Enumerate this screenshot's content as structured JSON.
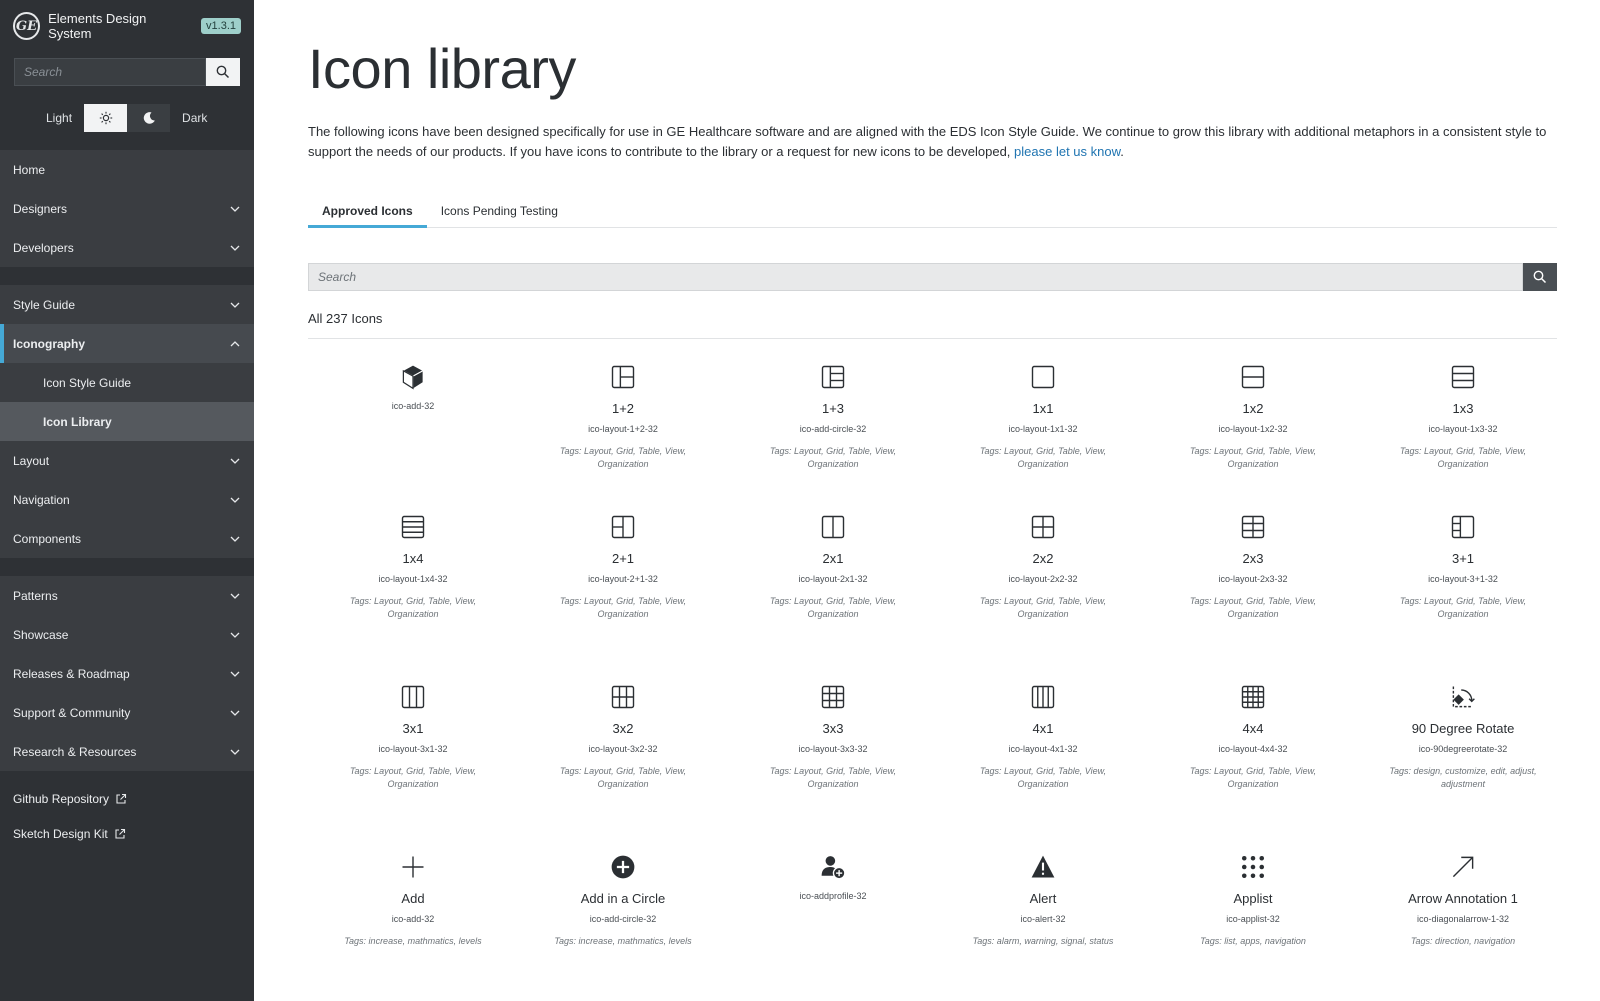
{
  "sidebar": {
    "brand_logo": "GE",
    "brand_name": "Elements Design System",
    "version": "v1.3.1",
    "search_placeholder": "Search",
    "theme_light": "Light",
    "theme_dark": "Dark",
    "nav": {
      "home": "Home",
      "designers": "Designers",
      "developers": "Developers",
      "style_guide": "Style Guide",
      "iconography": "Iconography",
      "icon_style_guide": "Icon Style Guide",
      "icon_library": "Icon Library",
      "layout": "Layout",
      "navigation": "Navigation",
      "components": "Components",
      "patterns": "Patterns",
      "showcase": "Showcase",
      "releases": "Releases & Roadmap",
      "support": "Support & Community",
      "research": "Research & Resources"
    },
    "links": {
      "github": "Github Repository",
      "sketch": "Sketch Design Kit"
    }
  },
  "main": {
    "title": "Icon library",
    "intro_text": "The following icons have been designed specifically for use in GE Healthcare software and are aligned with the EDS Icon Style Guide. We continue to grow this library with additional metaphors in a consistent style to support the needs of our products. If you have icons to contribute to the library or a request for new icons to be developed, ",
    "intro_link": "please let us know",
    "intro_end": ".",
    "tabs": [
      "Approved Icons",
      "Icons Pending Testing"
    ],
    "search_placeholder": "Search",
    "count_label": "All 237 Icons"
  },
  "icons": [
    [
      {
        "icon": "cube-icon",
        "name": "",
        "code": "ico-add-32",
        "tags": ""
      },
      {
        "icon": "layout-1-2-icon",
        "name": "1+2",
        "code": "ico-layout-1+2-32",
        "tags": "Tags: Layout, Grid, Table, View, Organization"
      },
      {
        "icon": "layout-1-3-icon",
        "name": "1+3",
        "code": "ico-add-circle-32",
        "tags": "Tags: Layout, Grid, Table, View, Organization"
      },
      {
        "icon": "layout-1x1-icon",
        "name": "1x1",
        "code": "ico-layout-1x1-32",
        "tags": "Tags: Layout, Grid, Table, View, Organization"
      },
      {
        "icon": "layout-1x2-icon",
        "name": "1x2",
        "code": "ico-layout-1x2-32",
        "tags": "Tags: Layout, Grid, Table, View, Organization"
      },
      {
        "icon": "layout-1x3-icon",
        "name": "1x3",
        "code": "ico-layout-1x3-32",
        "tags": "Tags: Layout, Grid, Table, View, Organization"
      }
    ],
    [
      {
        "icon": "layout-1x4-icon",
        "name": "1x4",
        "code": "ico-layout-1x4-32",
        "tags": "Tags: Layout, Grid, Table, View, Organization"
      },
      {
        "icon": "layout-2-1-icon",
        "name": "2+1",
        "code": "ico-layout-2+1-32",
        "tags": "Tags: Layout, Grid, Table, View, Organization"
      },
      {
        "icon": "layout-2x1-icon",
        "name": "2x1",
        "code": "ico-layout-2x1-32",
        "tags": "Tags: Layout, Grid, Table, View, Organization"
      },
      {
        "icon": "layout-2x2-icon",
        "name": "2x2",
        "code": "ico-layout-2x2-32",
        "tags": "Tags: Layout, Grid, Table, View, Organization"
      },
      {
        "icon": "layout-2x3-icon",
        "name": "2x3",
        "code": "ico-layout-2x3-32",
        "tags": "Tags: Layout, Grid, Table, View, Organization"
      },
      {
        "icon": "layout-3-1-icon",
        "name": "3+1",
        "code": "ico-layout-3+1-32",
        "tags": "Tags: Layout, Grid, Table, View, Organization"
      }
    ],
    [
      {
        "icon": "layout-3x1-icon",
        "name": "3x1",
        "code": "ico-layout-3x1-32",
        "tags": "Tags: Layout, Grid, Table, View, Organization"
      },
      {
        "icon": "layout-3x2-icon",
        "name": "3x2",
        "code": "ico-layout-3x2-32",
        "tags": "Tags: Layout, Grid, Table, View, Organization"
      },
      {
        "icon": "layout-3x3-icon",
        "name": "3x3",
        "code": "ico-layout-3x3-32",
        "tags": "Tags: Layout, Grid, Table, View, Organization"
      },
      {
        "icon": "layout-4x1-icon",
        "name": "4x1",
        "code": "ico-layout-4x1-32",
        "tags": "Tags: Layout, Grid, Table, View, Organization"
      },
      {
        "icon": "layout-4x4-icon",
        "name": "4x4",
        "code": "ico-layout-4x4-32",
        "tags": "Tags: Layout, Grid, Table, View, Organization"
      },
      {
        "icon": "rotate-90-icon",
        "name": "90 Degree Rotate",
        "code": "ico-90degreerotate-32",
        "tags": "Tags: design, customize, edit, adjust, adjustment"
      }
    ],
    [
      {
        "icon": "plus-icon",
        "name": "Add",
        "code": "ico-add-32",
        "tags": "Tags: increase, mathmatics, levels"
      },
      {
        "icon": "plus-circle-icon",
        "name": "Add in a Circle",
        "code": "ico-add-circle-32",
        "tags": "Tags: increase, mathmatics, levels"
      },
      {
        "icon": "add-profile-icon",
        "name": "",
        "code": "ico-addprofile-32",
        "tags": ""
      },
      {
        "icon": "alert-icon",
        "name": "Alert",
        "code": "ico-alert-32",
        "tags": "Tags: alarm, warning, signal, status"
      },
      {
        "icon": "applist-icon",
        "name": "Applist",
        "code": "ico-applist-32",
        "tags": "Tags: list, apps, navigation"
      },
      {
        "icon": "diagonal-arrow-icon",
        "name": "Arrow Annotation 1",
        "code": "ico-diagonalarrow-1-32",
        "tags": "Tags: direction, navigation"
      }
    ]
  ],
  "colors": {
    "sidebar_bg": "#2e3135",
    "accent": "#45a9d6",
    "link": "#1f74b1",
    "version_badge": "#9ecfca"
  }
}
